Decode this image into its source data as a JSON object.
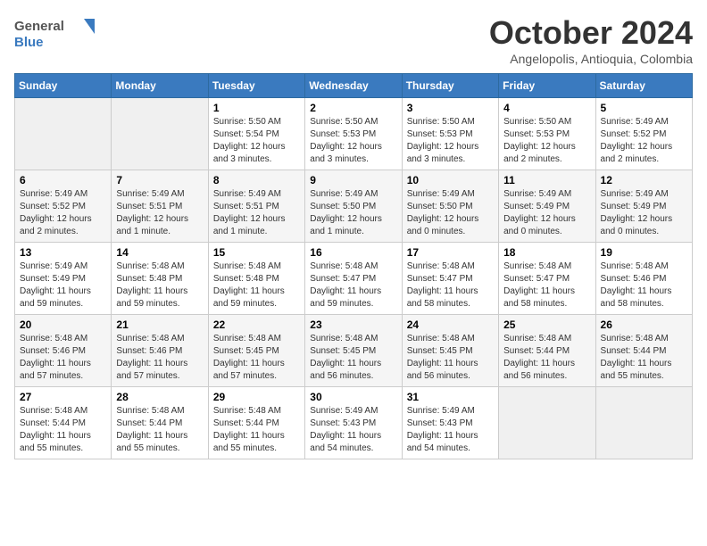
{
  "header": {
    "logo_line1": "General",
    "logo_line2": "Blue",
    "month": "October 2024",
    "location": "Angelopolis, Antioquia, Colombia"
  },
  "weekdays": [
    "Sunday",
    "Monday",
    "Tuesday",
    "Wednesday",
    "Thursday",
    "Friday",
    "Saturday"
  ],
  "weeks": [
    [
      {
        "day": "",
        "empty": true
      },
      {
        "day": "",
        "empty": true
      },
      {
        "day": "1",
        "sunrise": "5:50 AM",
        "sunset": "5:54 PM",
        "daylight": "12 hours and 3 minutes."
      },
      {
        "day": "2",
        "sunrise": "5:50 AM",
        "sunset": "5:53 PM",
        "daylight": "12 hours and 3 minutes."
      },
      {
        "day": "3",
        "sunrise": "5:50 AM",
        "sunset": "5:53 PM",
        "daylight": "12 hours and 3 minutes."
      },
      {
        "day": "4",
        "sunrise": "5:50 AM",
        "sunset": "5:53 PM",
        "daylight": "12 hours and 2 minutes."
      },
      {
        "day": "5",
        "sunrise": "5:49 AM",
        "sunset": "5:52 PM",
        "daylight": "12 hours and 2 minutes."
      }
    ],
    [
      {
        "day": "6",
        "sunrise": "5:49 AM",
        "sunset": "5:52 PM",
        "daylight": "12 hours and 2 minutes."
      },
      {
        "day": "7",
        "sunrise": "5:49 AM",
        "sunset": "5:51 PM",
        "daylight": "12 hours and 1 minute."
      },
      {
        "day": "8",
        "sunrise": "5:49 AM",
        "sunset": "5:51 PM",
        "daylight": "12 hours and 1 minute."
      },
      {
        "day": "9",
        "sunrise": "5:49 AM",
        "sunset": "5:50 PM",
        "daylight": "12 hours and 1 minute."
      },
      {
        "day": "10",
        "sunrise": "5:49 AM",
        "sunset": "5:50 PM",
        "daylight": "12 hours and 0 minutes."
      },
      {
        "day": "11",
        "sunrise": "5:49 AM",
        "sunset": "5:49 PM",
        "daylight": "12 hours and 0 minutes."
      },
      {
        "day": "12",
        "sunrise": "5:49 AM",
        "sunset": "5:49 PM",
        "daylight": "12 hours and 0 minutes."
      }
    ],
    [
      {
        "day": "13",
        "sunrise": "5:49 AM",
        "sunset": "5:49 PM",
        "daylight": "11 hours and 59 minutes."
      },
      {
        "day": "14",
        "sunrise": "5:48 AM",
        "sunset": "5:48 PM",
        "daylight": "11 hours and 59 minutes."
      },
      {
        "day": "15",
        "sunrise": "5:48 AM",
        "sunset": "5:48 PM",
        "daylight": "11 hours and 59 minutes."
      },
      {
        "day": "16",
        "sunrise": "5:48 AM",
        "sunset": "5:47 PM",
        "daylight": "11 hours and 59 minutes."
      },
      {
        "day": "17",
        "sunrise": "5:48 AM",
        "sunset": "5:47 PM",
        "daylight": "11 hours and 58 minutes."
      },
      {
        "day": "18",
        "sunrise": "5:48 AM",
        "sunset": "5:47 PM",
        "daylight": "11 hours and 58 minutes."
      },
      {
        "day": "19",
        "sunrise": "5:48 AM",
        "sunset": "5:46 PM",
        "daylight": "11 hours and 58 minutes."
      }
    ],
    [
      {
        "day": "20",
        "sunrise": "5:48 AM",
        "sunset": "5:46 PM",
        "daylight": "11 hours and 57 minutes."
      },
      {
        "day": "21",
        "sunrise": "5:48 AM",
        "sunset": "5:46 PM",
        "daylight": "11 hours and 57 minutes."
      },
      {
        "day": "22",
        "sunrise": "5:48 AM",
        "sunset": "5:45 PM",
        "daylight": "11 hours and 57 minutes."
      },
      {
        "day": "23",
        "sunrise": "5:48 AM",
        "sunset": "5:45 PM",
        "daylight": "11 hours and 56 minutes."
      },
      {
        "day": "24",
        "sunrise": "5:48 AM",
        "sunset": "5:45 PM",
        "daylight": "11 hours and 56 minutes."
      },
      {
        "day": "25",
        "sunrise": "5:48 AM",
        "sunset": "5:44 PM",
        "daylight": "11 hours and 56 minutes."
      },
      {
        "day": "26",
        "sunrise": "5:48 AM",
        "sunset": "5:44 PM",
        "daylight": "11 hours and 55 minutes."
      }
    ],
    [
      {
        "day": "27",
        "sunrise": "5:48 AM",
        "sunset": "5:44 PM",
        "daylight": "11 hours and 55 minutes."
      },
      {
        "day": "28",
        "sunrise": "5:48 AM",
        "sunset": "5:44 PM",
        "daylight": "11 hours and 55 minutes."
      },
      {
        "day": "29",
        "sunrise": "5:48 AM",
        "sunset": "5:44 PM",
        "daylight": "11 hours and 55 minutes."
      },
      {
        "day": "30",
        "sunrise": "5:49 AM",
        "sunset": "5:43 PM",
        "daylight": "11 hours and 54 minutes."
      },
      {
        "day": "31",
        "sunrise": "5:49 AM",
        "sunset": "5:43 PM",
        "daylight": "11 hours and 54 minutes."
      },
      {
        "day": "",
        "empty": true
      },
      {
        "day": "",
        "empty": true
      }
    ]
  ]
}
